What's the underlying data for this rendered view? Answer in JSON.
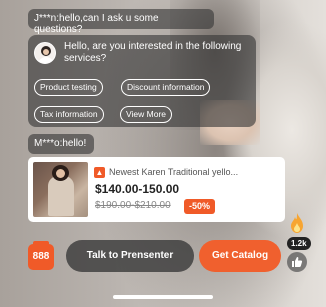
{
  "chat": {
    "question": "J***n:hello,can I ask u some questions?",
    "welcome": {
      "text": "Hello, are you interested in the following services?",
      "options": [
        "Product testing",
        "Discount information",
        "Tax information",
        "View More"
      ]
    },
    "hello_message": "M***o:hello!"
  },
  "product": {
    "hot_icon": "fire-icon",
    "title": "Newest Karen Traditional yello...",
    "price": "$140.00-150.00",
    "original_price": "$190.00-$210.00",
    "discount": "-50%"
  },
  "bottom_bar": {
    "badge": "888",
    "talk_label": "Talk to Prensenter",
    "catalog_label": "Get Catalog",
    "like_count": "1.2k"
  },
  "colors": {
    "accent": "#f05a28",
    "bubble": "#373737"
  }
}
